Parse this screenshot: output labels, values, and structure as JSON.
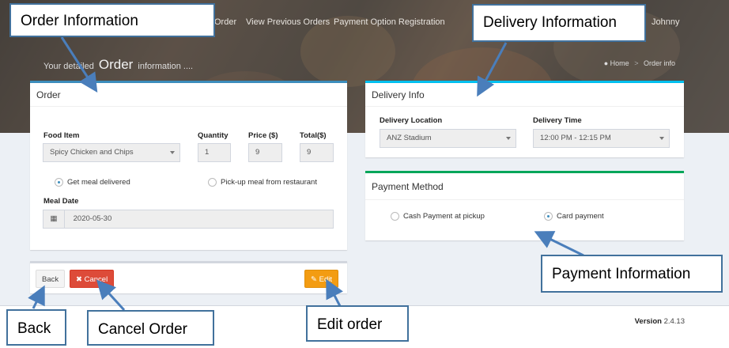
{
  "nav": {
    "links": [
      "Order",
      "View Previous Orders",
      "Payment Option Registration"
    ],
    "user": "Johnny"
  },
  "header": {
    "subtitle_prefix": "Your detailed",
    "subtitle_main": "Order",
    "subtitle_suffix": "information ....",
    "breadcrumb_home": "Home",
    "breadcrumb_current": "Order info"
  },
  "order": {
    "title": "Order",
    "food_label": "Food Item",
    "food_value": "Spicy Chicken and Chips",
    "quantity_label": "Quantity",
    "quantity_value": "1",
    "price_label": "Price ($)",
    "price_value": "9",
    "total_label": "Total($)",
    "total_value": "9",
    "radio_delivered": "Get meal delivered",
    "radio_pickup": "Pick-up meal from restaurant",
    "meal_date_label": "Meal Date",
    "meal_date_value": "2020-05-30"
  },
  "delivery": {
    "title": "Delivery Info",
    "location_label": "Delivery Location",
    "location_value": "ANZ Stadium",
    "time_label": "Delivery Time",
    "time_value": "12:00 PM - 12:15 PM"
  },
  "payment": {
    "title": "Payment Method",
    "cash_label": "Cash Payment at pickup",
    "card_label": "Card payment"
  },
  "actions": {
    "back": "Back",
    "cancel": "Cancel",
    "edit": "Edit"
  },
  "footer": {
    "version_label": "Version",
    "version_value": "2.4.13"
  },
  "annotations": {
    "order_info": "Order Information",
    "delivery_info": "Delivery Information",
    "payment_info": "Payment Information",
    "back": "Back",
    "cancel_order": "Cancel Order",
    "edit_order": "Edit order"
  },
  "colors": {
    "primary": "#3c8dbc",
    "danger": "#dd4b39",
    "warning": "#f39c12",
    "success": "#00a65a",
    "info": "#00c0ef",
    "callout_border": "#41719c"
  }
}
